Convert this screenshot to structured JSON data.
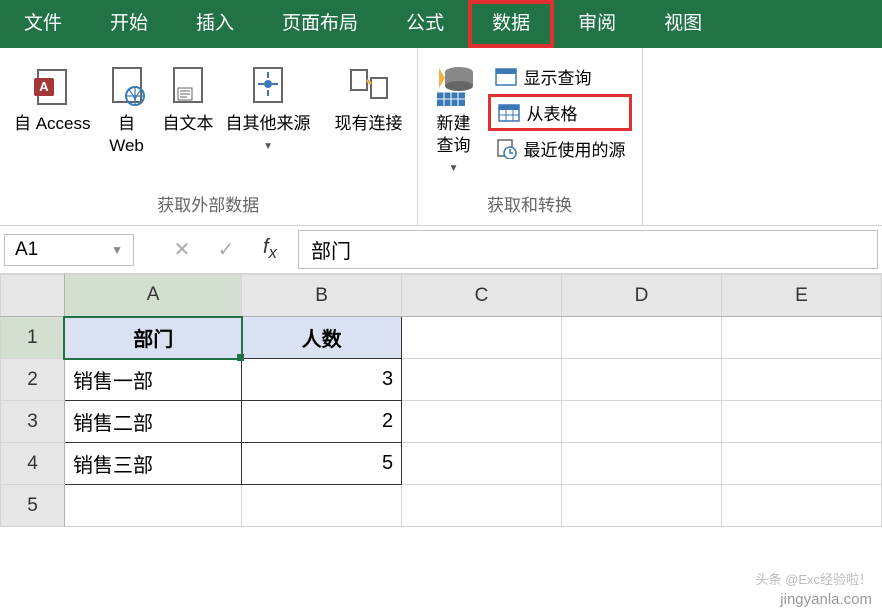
{
  "ribbon": {
    "tabs": [
      "文件",
      "开始",
      "插入",
      "页面布局",
      "公式",
      "数据",
      "审阅",
      "视图"
    ],
    "active_index": 5,
    "groups": {
      "external": {
        "label": "获取外部数据",
        "from_access": "自 Access",
        "from_web": "自\nWeb",
        "from_text": "自文本",
        "from_other": "自其他来源",
        "existing_conn": "现有连接"
      },
      "transform": {
        "label": "获取和转换",
        "new_query": "新建\n查询",
        "show_queries": "显示查询",
        "from_table": "从表格",
        "recent": "最近使用的源"
      }
    }
  },
  "formula_bar": {
    "name_box": "A1",
    "value": "部门"
  },
  "sheet": {
    "columns": [
      "A",
      "B",
      "C",
      "D",
      "E"
    ],
    "rows": [
      1,
      2,
      3,
      4,
      5
    ],
    "headers": {
      "a": "部门",
      "b": "人数"
    },
    "data": [
      {
        "dept": "销售一部",
        "count": 3
      },
      {
        "dept": "销售二部",
        "count": 2
      },
      {
        "dept": "销售三部",
        "count": 5
      }
    ]
  },
  "watermark": {
    "line1": "头条 @Exc经验啦！",
    "line2": "jingyanla.com"
  }
}
